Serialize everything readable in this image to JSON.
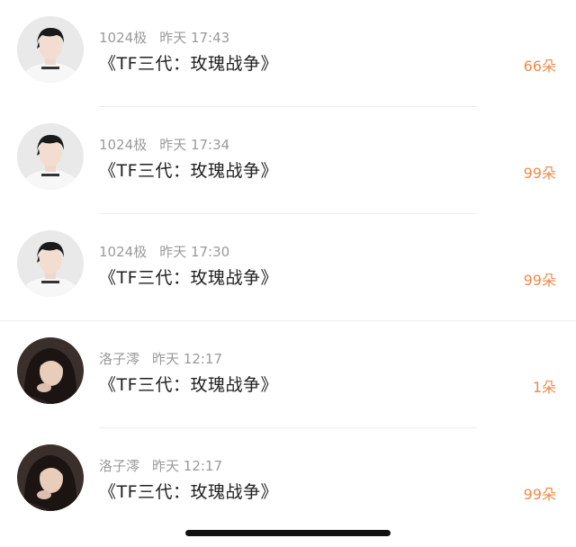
{
  "messages": [
    {
      "sender": "1024极",
      "time": "昨天 17:43",
      "title": "《TF三代：玫瑰战争》",
      "count": "66朵",
      "avatar": "boy-avatar-icon"
    },
    {
      "sender": "1024极",
      "time": "昨天 17:34",
      "title": "《TF三代：玫瑰战争》",
      "count": "99朵",
      "avatar": "boy-avatar-icon"
    },
    {
      "sender": "1024极",
      "time": "昨天 17:30",
      "title": "《TF三代：玫瑰战争》",
      "count": "99朵",
      "avatar": "boy-avatar-icon"
    },
    {
      "sender": "洛子澪",
      "time": "昨天 12:17",
      "title": "《TF三代：玫瑰战争》",
      "count": "1朵",
      "avatar": "girl-avatar-icon"
    },
    {
      "sender": "洛子澪",
      "time": "昨天 12:17",
      "title": "《TF三代：玫瑰战争》",
      "count": "99朵",
      "avatar": "girl-avatar-icon"
    }
  ],
  "colors": {
    "count": "#f08a4c",
    "meta": "#9a9a9a",
    "title": "#1f1f1f"
  }
}
